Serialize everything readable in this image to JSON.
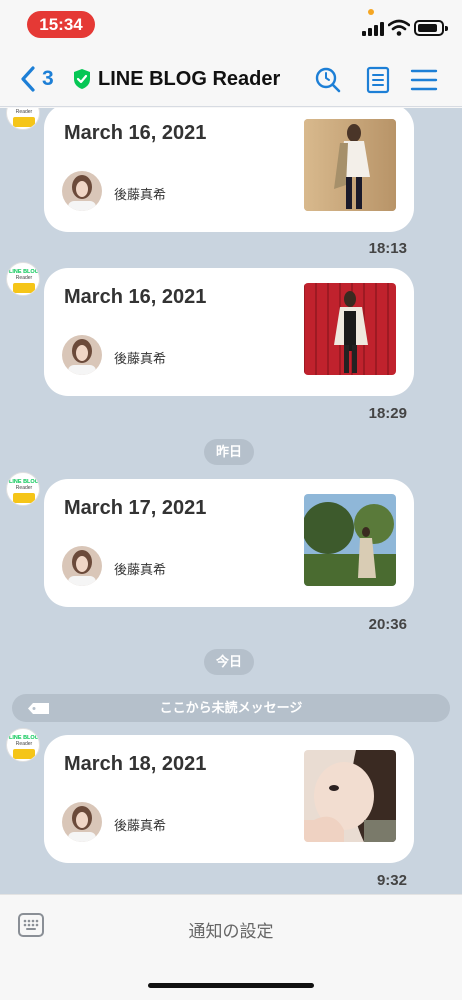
{
  "status_bar": {
    "time": "15:34"
  },
  "nav": {
    "back_count": "3",
    "title": "LINE BLOG Reader",
    "icons": [
      "back-chevron-icon",
      "verified-shield-icon",
      "search-history-icon",
      "notes-icon",
      "menu-icon"
    ]
  },
  "bot": {
    "logo_line1": "LINE BLOG",
    "logo_line2": "Reader"
  },
  "messages": [
    {
      "date": "March 16, 2021",
      "author": "後藤真希",
      "time": "18:13"
    },
    {
      "date": "March 16, 2021",
      "author": "後藤真希",
      "time": "18:29"
    },
    {
      "date": "March 17, 2021",
      "author": "後藤真希",
      "time": "20:36"
    },
    {
      "date": "March 18, 2021",
      "author": "後藤真希",
      "time": "9:32"
    }
  ],
  "dividers": {
    "yesterday": "昨日",
    "today": "今日",
    "unread": "ここから未読メッセージ"
  },
  "footer": {
    "label": "通知の設定"
  },
  "colors": {
    "accent": "#1d7fd6",
    "chat_bg": "#c9d4df",
    "status_pill": "#e53935",
    "shield": "#06c755"
  }
}
